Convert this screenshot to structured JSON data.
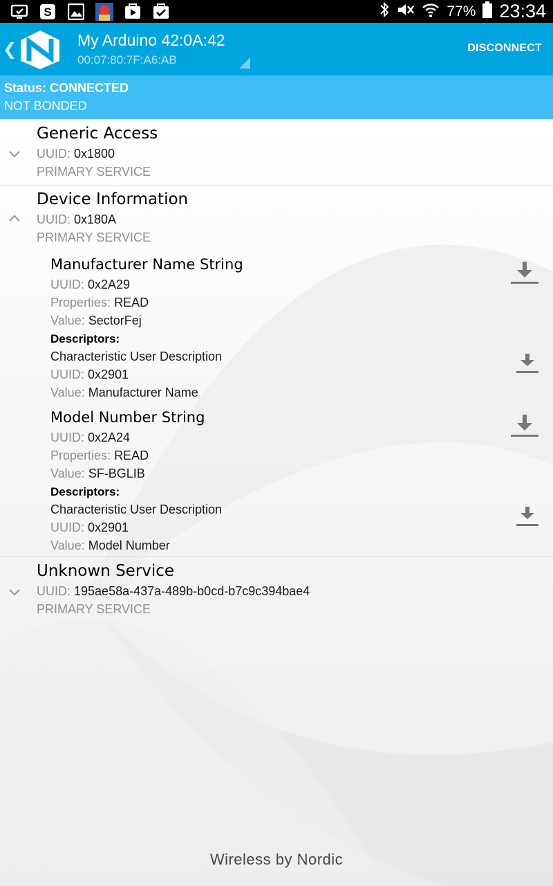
{
  "status_bar": {
    "icons": [
      "cast-icon",
      "skype-icon",
      "gallery-icon",
      "avatar-icon",
      "play-store-icon",
      "task-check-icon"
    ],
    "battery_percent": "77%",
    "time": "23:34"
  },
  "header": {
    "device_name": "My Arduino 42:0A:42",
    "device_address": "00:07:80:7F:A6:AB",
    "disconnect_label": "DISCONNECT"
  },
  "connection": {
    "status": "Status: CONNECTED",
    "bond": "NOT BONDED"
  },
  "labels": {
    "uuid": "UUID:",
    "properties": "Properties:",
    "value": "Value:",
    "descriptors": "Descriptors:"
  },
  "services": [
    {
      "name": "Generic Access",
      "uuid": "0x1800",
      "type": "PRIMARY SERVICE",
      "expanded": false
    },
    {
      "name": "Device Information",
      "uuid": "0x180A",
      "type": "PRIMARY SERVICE",
      "expanded": true,
      "characteristics": [
        {
          "name": "Manufacturer Name String",
          "uuid": "0x2A29",
          "properties": "READ",
          "value": "SectorFej",
          "descriptor": {
            "name": "Characteristic User Description",
            "uuid": "0x2901",
            "value": "Manufacturer Name"
          }
        },
        {
          "name": "Model Number String",
          "uuid": "0x2A24",
          "properties": "READ",
          "value": "SF-BGLIB",
          "descriptor": {
            "name": "Characteristic User Description",
            "uuid": "0x2901",
            "value": "Model Number"
          }
        }
      ]
    },
    {
      "name": "Unknown Service",
      "uuid": "195ae58a-437a-489b-b0cd-b7c9c394bae4",
      "type": "PRIMARY SERVICE",
      "expanded": false
    }
  ],
  "footer": "Wireless by Nordic",
  "colors": {
    "action_bar": "#00a5e0",
    "status_strip": "#3fbdf5",
    "label_gray": "#8f8f8f"
  }
}
